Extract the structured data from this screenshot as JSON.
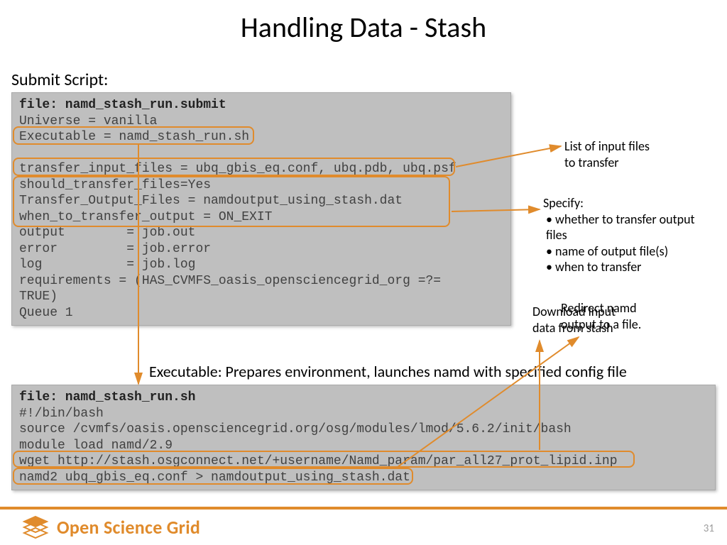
{
  "title": "Handling Data - Stash",
  "sections": {
    "submit_label": "Submit Script:",
    "exec_note": "Executable:  Prepares environment, launches namd with specified config file"
  },
  "codeblock1": {
    "file_label": "file: namd_stash_run.submit",
    "lines": "Universe = vanilla\nExecutable = namd_stash_run.sh\n\ntransfer_input_files = ubq_gbis_eq.conf, ubq.pdb, ubq.psf\nshould_transfer_files=Yes\nTransfer_Output_Files = namdoutput_using_stash.dat\nwhen_to_transfer_output = ON_EXIT\noutput        = job.out\nerror         = job.error\nlog           = job.log\nrequirements = (HAS_CVMFS_oasis_opensciencegrid_org =?=\nTRUE)\nQueue 1"
  },
  "codeblock2": {
    "file_label": "file: namd_stash_run.sh",
    "lines": "#!/bin/bash\nsource /cvmfs/oasis.opensciencegrid.org/osg/modules/lmod/5.6.2/init/bash\nmodule load namd/2.9\nwget http://stash.osgconnect.net/+username/Namd_param/par_all27_prot_lipid.inp\nnamd2 ubq_gbis_eq.conf > namdoutput_using_stash.dat"
  },
  "annotations": {
    "input_files": "List of input files\nto transfer",
    "specify_heading": "Specify:",
    "specify_items": [
      "whether to transfer output files",
      "name of output file(s)",
      "when to transfer"
    ],
    "download": "Download input\ndata from stash",
    "redirect": "Redirect namd\noutput to a file."
  },
  "footer": {
    "brand": "Open Science Grid",
    "page": "31"
  }
}
